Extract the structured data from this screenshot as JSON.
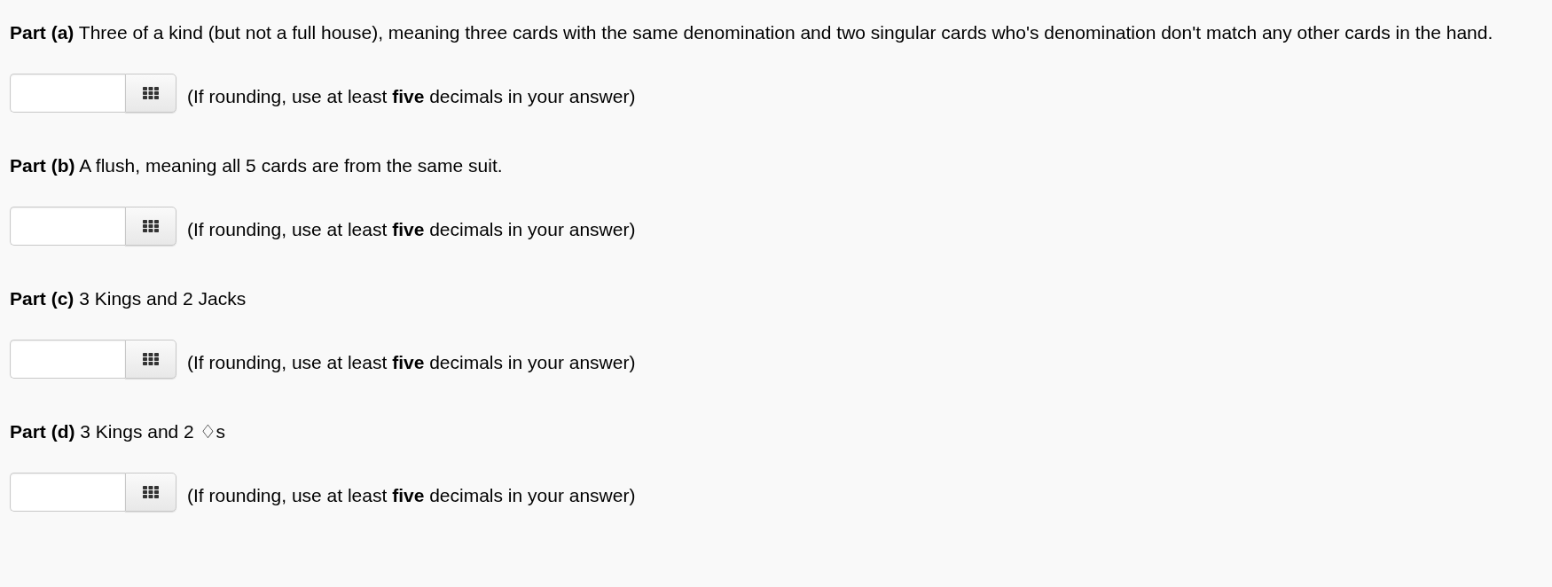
{
  "parts": [
    {
      "question": "**Part (a)** Three of a kind (but not a full house), meaning three cards with the same denomination and two singular cards who's denomination don't match any other cards in the hand.",
      "hint": "(If rounding, use at least **five** decimals in your answer)"
    },
    {
      "question": "**Part (b)** A flush, meaning all 5 cards are from the same suit.",
      "hint": "(If rounding, use at least **five** decimals in your answer)"
    },
    {
      "question": "**Part (c)** 3 Kings and 2 Jacks",
      "hint": "(If rounding, use at least **five** decimals in your answer)"
    },
    {
      "question": "**Part (d)** 3 Kings and 2 ♢s",
      "hint": "(If rounding, use at least **five** decimals in your answer)"
    }
  ]
}
